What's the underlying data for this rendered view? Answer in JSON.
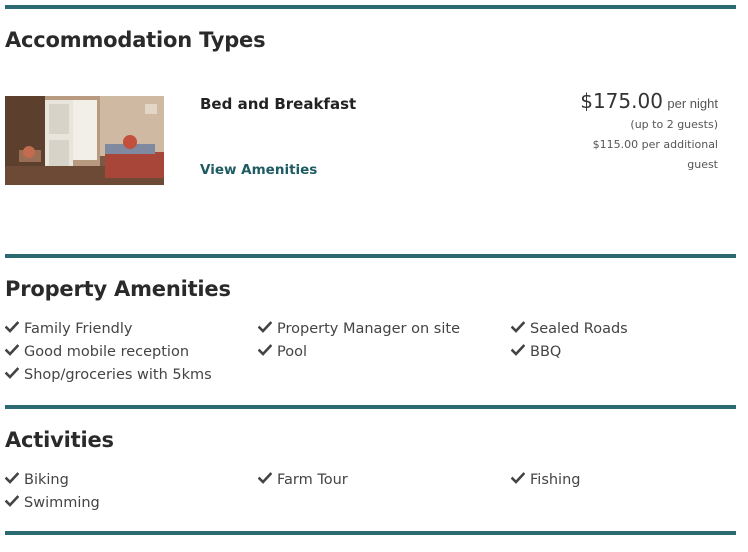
{
  "accommodation": {
    "heading": "Accommodation Types",
    "name": "Bed and Breakfast",
    "link": "View Amenities",
    "price": "$175.00",
    "per": "per night",
    "guests": "(up to 2 guests)",
    "extra_line1": "$115.00 per additional",
    "extra_line2": "guest"
  },
  "amenities": {
    "heading": "Property Amenities",
    "items": [
      "Family Friendly",
      "Property Manager on site",
      "Sealed Roads",
      "Good mobile reception",
      "Pool",
      "BBQ",
      "Shop/groceries with 5kms"
    ]
  },
  "activities": {
    "heading": "Activities",
    "items": [
      "Biking",
      "Farm Tour",
      "Fishing",
      "Swimming"
    ]
  },
  "colors": {
    "accent": "#2b6a70",
    "link": "#1e5b62"
  },
  "icons": {
    "check": "check-icon"
  }
}
